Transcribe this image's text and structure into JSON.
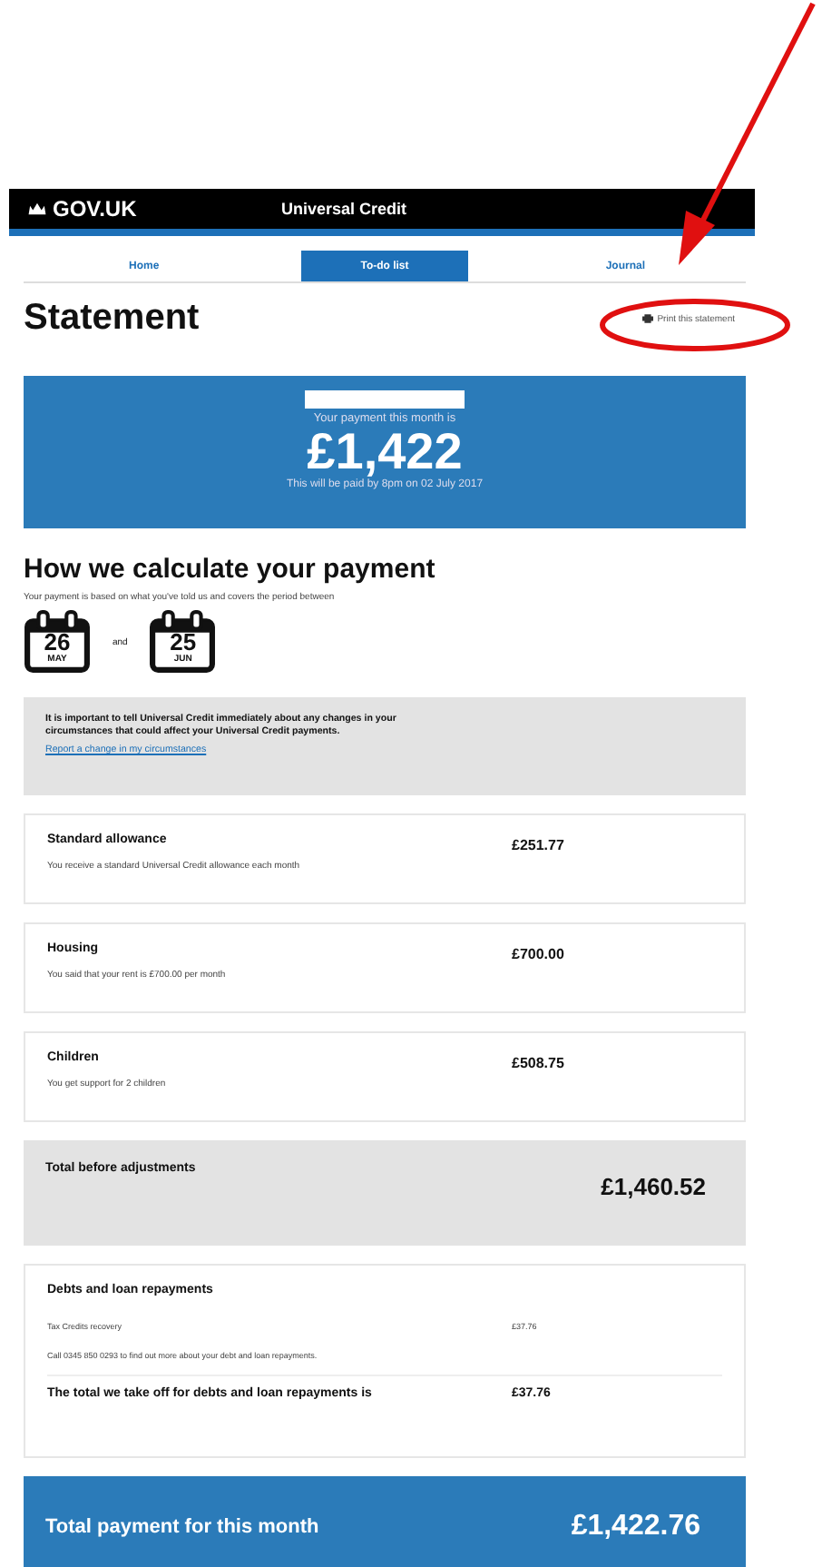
{
  "header": {
    "logo": "GOV.UK",
    "service": "Universal Credit"
  },
  "tabs": [
    {
      "label": "Home",
      "selected": false
    },
    {
      "label": "To-do list",
      "selected": true
    },
    {
      "label": "Journal",
      "selected": false
    }
  ],
  "title": "Statement",
  "print_link": "Print this statement",
  "summary": {
    "label": "Your payment this month is",
    "amount": "£1,422",
    "note": "This will be paid by 8pm on 02 July 2017"
  },
  "calculation": {
    "heading": "How we calculate your payment",
    "intro": "Your payment is based on what you've told us and covers the period between",
    "start": {
      "day": "26",
      "month": "MAY"
    },
    "joiner": "and",
    "end": {
      "day": "25",
      "month": "JUN"
    }
  },
  "notice": {
    "text": "It is important to tell Universal Credit immediately about any changes in your circumstances that could affect your Universal Credit payments.",
    "link": "Report a change in my circumstances"
  },
  "items": [
    {
      "title": "Standard allowance",
      "description": "You receive a standard Universal Credit allowance each month",
      "amount": "£251.77"
    },
    {
      "title": "Housing",
      "description": "You said that your rent is £700.00 per month",
      "amount": "£700.00"
    },
    {
      "title": "Children",
      "description": "You get support for 2 children",
      "amount": "£508.75"
    }
  ],
  "total_before": {
    "label": "Total before adjustments",
    "amount": "£1,460.52"
  },
  "debts": {
    "heading": "Debts and loan repayments",
    "line_label": "Tax Credits recovery",
    "line_amount": "£37.76",
    "info": "Call 0345 850 0293 to find out more about your debt and loan repayments.",
    "total_label": "The total we take off for debts and loan repayments is",
    "total_amount": "£37.76"
  },
  "total_payment": {
    "label": "Total payment for this month",
    "amount": "£1,422.76"
  }
}
